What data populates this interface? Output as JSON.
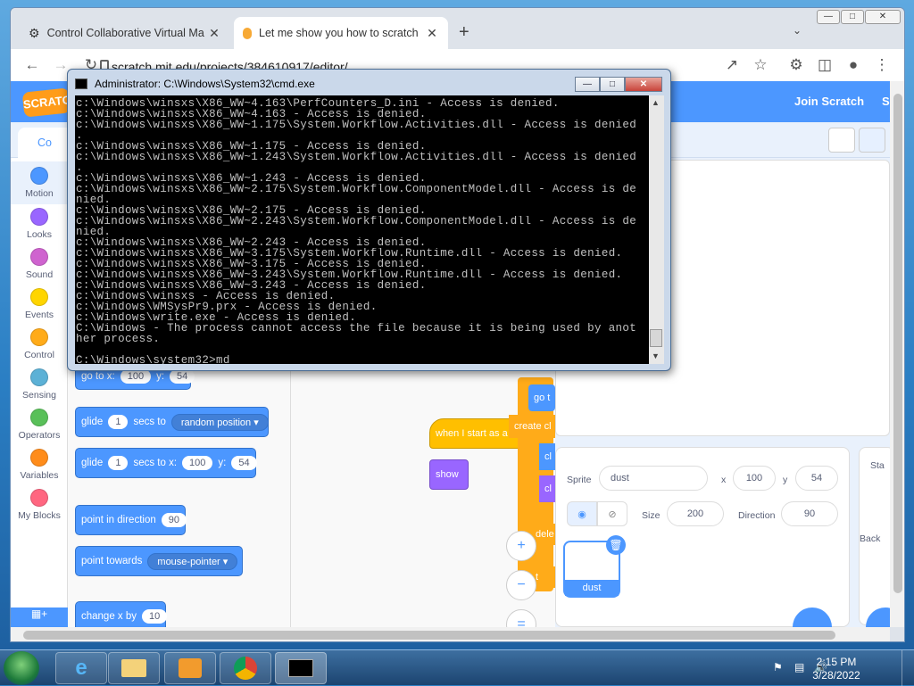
{
  "browser": {
    "tabs": [
      {
        "title": "Control Collaborative Virtual Ma",
        "icon": "vm-icon"
      },
      {
        "title": "Let me show you how to scratch",
        "icon": "scratch-icon"
      }
    ],
    "new_tab": "+",
    "url": "scratch.mit.edu/projects/384610917/editor/"
  },
  "scratch": {
    "logo": "SCRATCH",
    "join": "Join Scratch",
    "signin": "S",
    "code_tab": "Co",
    "categories": [
      {
        "label": "Motion",
        "color": "#4c97ff"
      },
      {
        "label": "Looks",
        "color": "#9966ff"
      },
      {
        "label": "Sound",
        "color": "#cf63cf"
      },
      {
        "label": "Events",
        "color": "#ffd500"
      },
      {
        "label": "Control",
        "color": "#ffab19"
      },
      {
        "label": "Sensing",
        "color": "#5cb1d6"
      },
      {
        "label": "Operators",
        "color": "#59c059"
      },
      {
        "label": "Variables",
        "color": "#ff8c1a"
      },
      {
        "label": "My Blocks",
        "color": "#ff6680"
      }
    ],
    "blocks": {
      "goto": {
        "label": "go to x:",
        "x": "100",
        "ylab": "y:",
        "y": "54"
      },
      "glide1": {
        "label": "glide",
        "secs": "1",
        "mid": "secs to",
        "target": "random position"
      },
      "glide2": {
        "label": "glide",
        "secs": "1",
        "mid": "secs to x:",
        "x": "100",
        "ylab": "y:",
        "y": "54"
      },
      "point_dir": {
        "label": "point in direction",
        "value": "90"
      },
      "point_towards": {
        "label": "point towards",
        "target": "mouse-pointer"
      },
      "change_x": {
        "label": "change x by",
        "value": "10"
      }
    },
    "workspace": {
      "hat": "when I start as a clone",
      "show": "show",
      "go": "go t",
      "create": "create cl",
      "cl1": "cl",
      "cl2": "cl",
      "dele": "dele",
      "t": "t"
    },
    "sprite": {
      "sprite_label": "Sprite",
      "name": "dust",
      "x_label": "x",
      "x": "100",
      "y_label": "y",
      "y": "54",
      "size_label": "Size",
      "size": "200",
      "direction_label": "Direction",
      "direction": "90",
      "thumb_name": "dust"
    },
    "stage_label": "Sta",
    "backdrop_label": "Back"
  },
  "cmd": {
    "title": "Administrator: C:\\Windows\\System32\\cmd.exe",
    "lines": [
      "c:\\Windows\\winsxs\\X86_WW~4.163\\PerfCounters_D.ini - Access is denied.",
      "c:\\Windows\\winsxs\\X86_WW~4.163 - Access is denied.",
      "c:\\Windows\\winsxs\\X86_WW~1.175\\System.Workflow.Activities.dll - Access is denied",
      ".",
      "c:\\Windows\\winsxs\\X86_WW~1.175 - Access is denied.",
      "c:\\Windows\\winsxs\\X86_WW~1.243\\System.Workflow.Activities.dll - Access is denied",
      ".",
      "c:\\Windows\\winsxs\\X86_WW~1.243 - Access is denied.",
      "c:\\Windows\\winsxs\\X86_WW~2.175\\System.Workflow.ComponentModel.dll - Access is de",
      "nied.",
      "c:\\Windows\\winsxs\\X86_WW~2.175 - Access is denied.",
      "c:\\Windows\\winsxs\\X86_WW~2.243\\System.Workflow.ComponentModel.dll - Access is de",
      "nied.",
      "c:\\Windows\\winsxs\\X86_WW~2.243 - Access is denied.",
      "c:\\Windows\\winsxs\\X86_WW~3.175\\System.Workflow.Runtime.dll - Access is denied.",
      "c:\\Windows\\winsxs\\X86_WW~3.175 - Access is denied.",
      "c:\\Windows\\winsxs\\X86_WW~3.243\\System.Workflow.Runtime.dll - Access is denied.",
      "c:\\Windows\\winsxs\\X86_WW~3.243 - Access is denied.",
      "c:\\Windows\\winsxs - Access is denied.",
      "c:\\Windows\\WMSysPr9.prx - Access is denied.",
      "c:\\Windows\\write.exe - Access is denied.",
      "C:\\Windows - The process cannot access the file because it is being used by anot",
      "her process.",
      "",
      "C:\\Windows\\system32>md _"
    ]
  },
  "taskbar": {
    "time": "2:15 PM",
    "date": "3/28/2022"
  }
}
